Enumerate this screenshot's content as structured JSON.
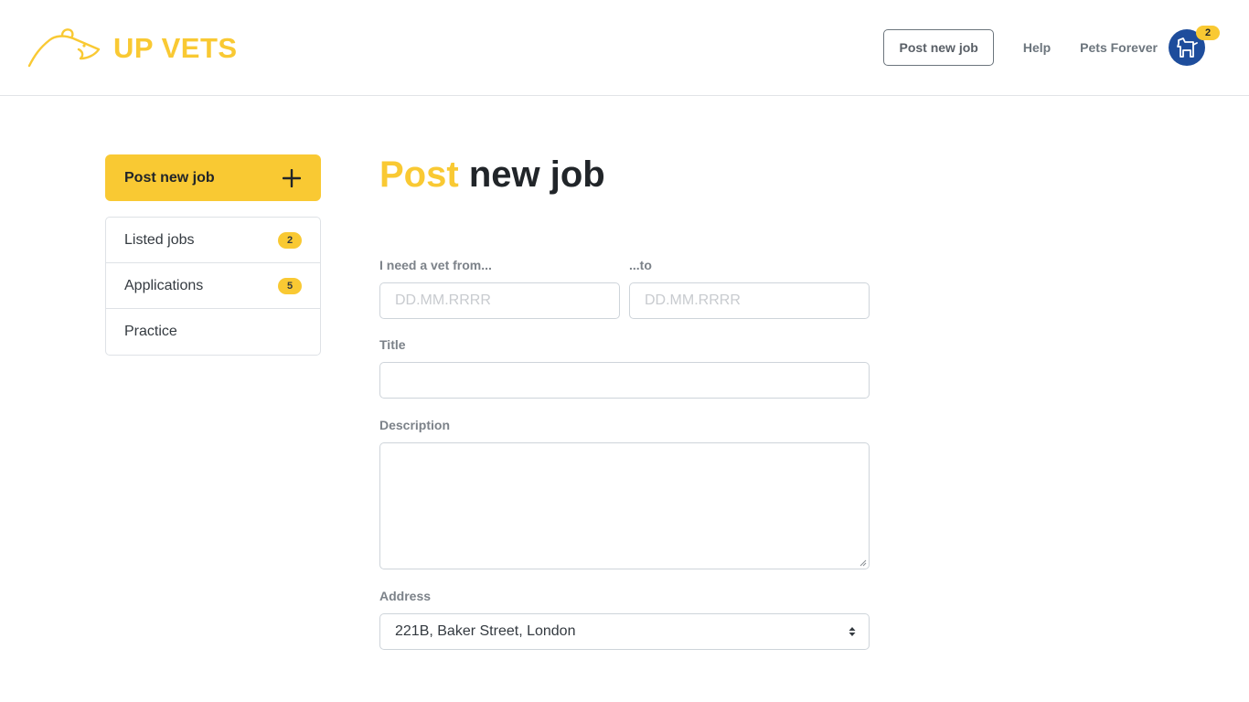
{
  "app": {
    "brand": "UP VETS",
    "brand_color": "#f9c933"
  },
  "header": {
    "post_job_label": "Post new job",
    "help_label": "Help",
    "user_name": "Pets Forever",
    "notification_count": "2",
    "avatar_icon": "dog-icon"
  },
  "sidebar": {
    "primary_action": "Post new job",
    "primary_icon": "plus-icon",
    "items": [
      {
        "label": "Listed jobs",
        "count": "2"
      },
      {
        "label": "Applications",
        "count": "5"
      },
      {
        "label": "Practice"
      }
    ]
  },
  "main": {
    "title_accent": "Post",
    "title_rest": "new job",
    "form": {
      "from_label": "I need a vet from...",
      "from_placeholder": "DD.MM.RRRR",
      "to_label": "...to",
      "to_placeholder": "DD.MM.RRRR",
      "title_label": "Title",
      "title_value": "",
      "description_label": "Description",
      "description_value": "",
      "address_label": "Address",
      "address_value": "221B, Baker Street, London"
    }
  }
}
